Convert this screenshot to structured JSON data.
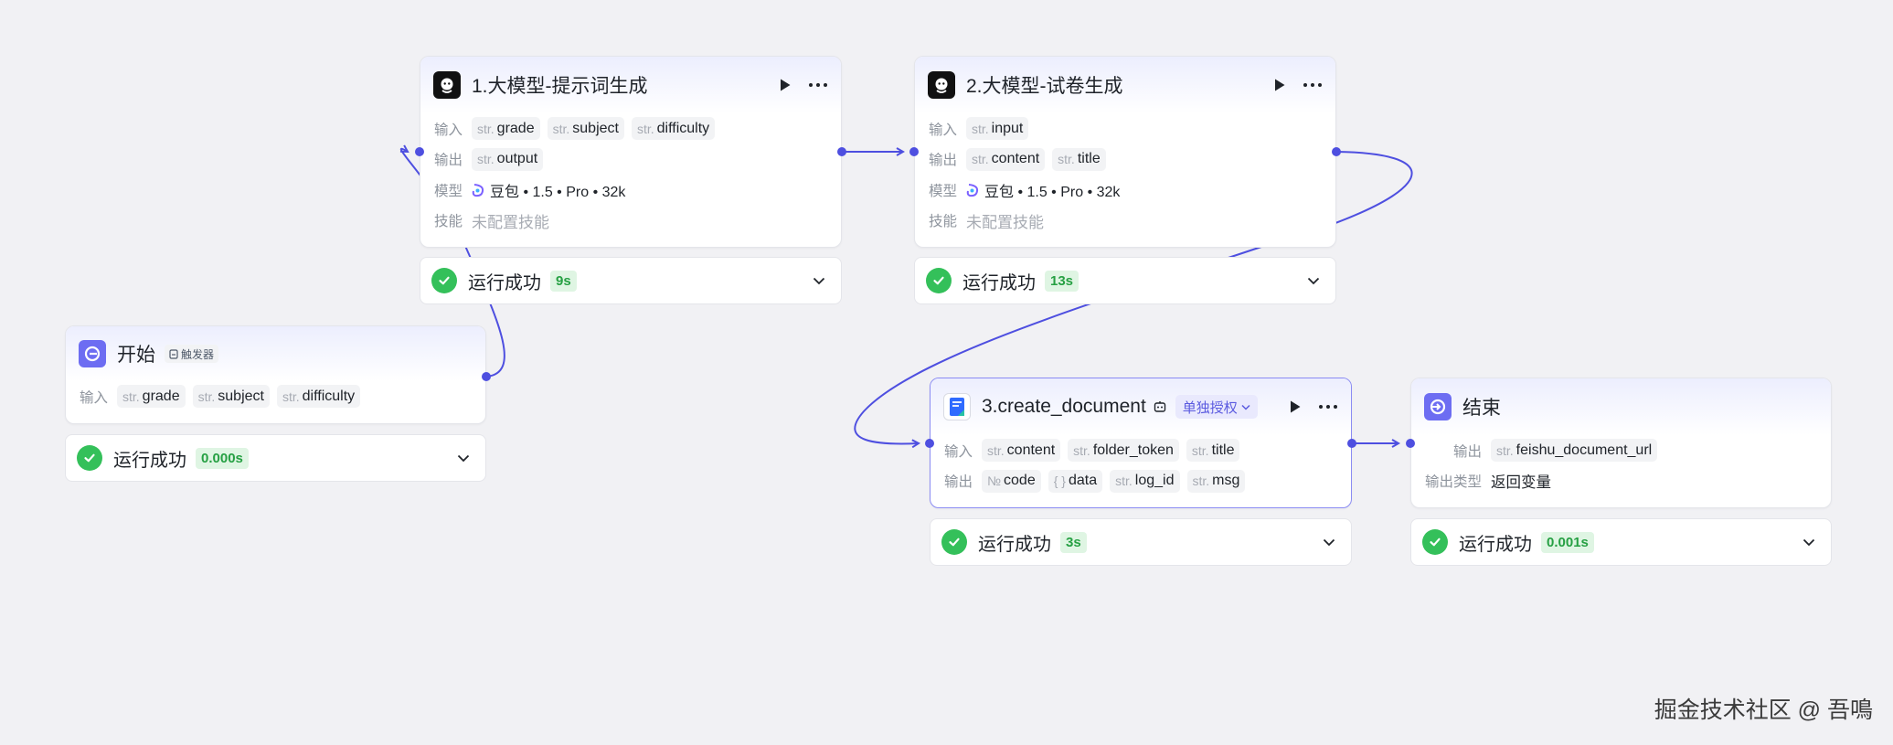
{
  "colors": {
    "edge": "#4e4fe0",
    "success": "#34c05a",
    "accent": "#6d6df2"
  },
  "nodes": {
    "start": {
      "title": "开始",
      "badge": "触发器",
      "input_label": "输入",
      "inputs": [
        {
          "type": "str.",
          "name": "grade"
        },
        {
          "type": "str.",
          "name": "subject"
        },
        {
          "type": "str.",
          "name": "difficulty"
        }
      ],
      "status": "运行成功",
      "time": "0.000s"
    },
    "llm1": {
      "title": "1.大模型-提示词生成",
      "input_label": "输入",
      "inputs": [
        {
          "type": "str.",
          "name": "grade"
        },
        {
          "type": "str.",
          "name": "subject"
        },
        {
          "type": "str.",
          "name": "difficulty"
        }
      ],
      "output_label": "输出",
      "outputs": [
        {
          "type": "str.",
          "name": "output"
        }
      ],
      "model_label": "模型",
      "model": "豆包 • 1.5 • Pro • 32k",
      "skill_label": "技能",
      "skill": "未配置技能",
      "status": "运行成功",
      "time": "9s"
    },
    "llm2": {
      "title": "2.大模型-试卷生成",
      "input_label": "输入",
      "inputs": [
        {
          "type": "str.",
          "name": "input"
        }
      ],
      "output_label": "输出",
      "outputs": [
        {
          "type": "str.",
          "name": "content"
        },
        {
          "type": "str.",
          "name": "title"
        }
      ],
      "model_label": "模型",
      "model": "豆包 • 1.5 • Pro • 32k",
      "skill_label": "技能",
      "skill": "未配置技能",
      "status": "运行成功",
      "time": "13s"
    },
    "doc": {
      "title": "3.create_document",
      "auth": "单独授权",
      "input_label": "输入",
      "inputs": [
        {
          "type": "str.",
          "name": "content"
        },
        {
          "type": "str.",
          "name": "folder_token"
        },
        {
          "type": "str.",
          "name": "title"
        }
      ],
      "output_label": "输出",
      "outputs": [
        {
          "type": "№",
          "name": "code"
        },
        {
          "type": "{ }",
          "name": "data"
        },
        {
          "type": "str.",
          "name": "log_id"
        },
        {
          "type": "str.",
          "name": "msg"
        }
      ],
      "status": "运行成功",
      "time": "3s"
    },
    "end": {
      "title": "结束",
      "output_label": "输出",
      "outputs": [
        {
          "type": "str.",
          "name": "feishu_document_url"
        }
      ],
      "output_type_label": "输出类型",
      "output_type": "返回变量",
      "status": "运行成功",
      "time": "0.001s"
    }
  },
  "watermark": "掘金技术社区 @ 吾鳴"
}
